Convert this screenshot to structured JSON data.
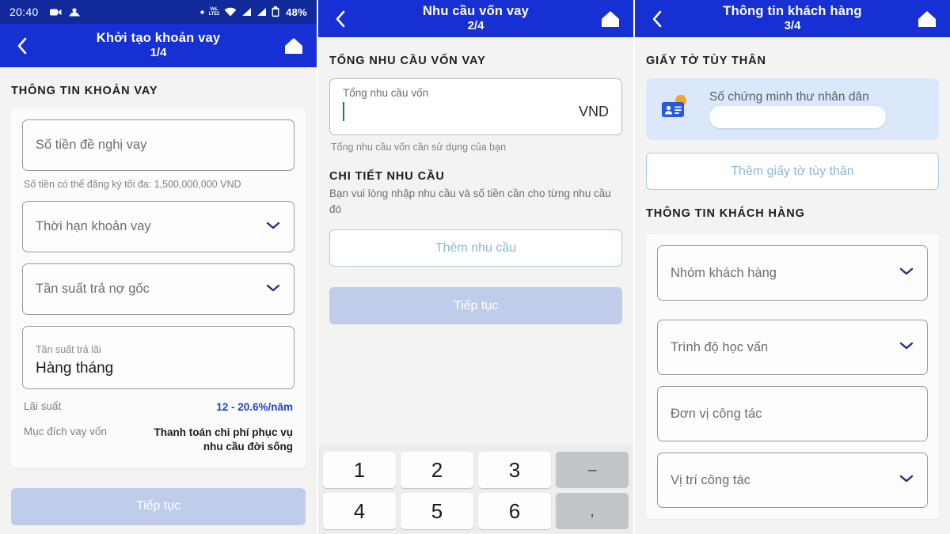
{
  "status_bar": {
    "time": "20:40",
    "battery": "48%",
    "network_label": "LTE2",
    "icons": [
      "camera-icon",
      "vpn-icon",
      "dot-icon",
      "volte-icon",
      "wifi-icon",
      "signal-icon",
      "signal-2-icon",
      "battery-icon"
    ]
  },
  "panel1": {
    "header": {
      "title": "Khởi tạo khoản vay",
      "step": "1/4",
      "back": "‹",
      "home": "home-icon"
    },
    "section_title": "THÔNG TIN KHOẢN VAY",
    "amount_placeholder": "Số tiền đề nghị vay",
    "amount_helper": "Số tiền có thể đăng ký tối đa: 1,500,000,000 VND",
    "term_placeholder": "Thời hạn khoản vay",
    "principal_freq_placeholder": "Tần suất trả nợ gốc",
    "interest_freq_label": "Tần suất trả lãi",
    "interest_freq_value": "Hàng tháng",
    "rate_key": "Lãi suất",
    "rate_value": "12 - 20.6%/năm",
    "purpose_key": "Mục đích vay vốn",
    "purpose_value": "Thanh toán chi phí phục vụ nhu cầu đời sống",
    "continue_label": "Tiếp tục"
  },
  "panel2": {
    "header": {
      "title": "Nhu cầu vốn vay",
      "step": "2/4",
      "back": "‹",
      "home": "home-icon"
    },
    "section_title": "TỔNG NHU CẦU VỐN VAY",
    "total_label": "Tổng nhu cầu vốn",
    "total_value": "",
    "total_unit": "VND",
    "total_helper": "Tổng nhu cầu vốn cần sử dụng của bạn",
    "detail_title": "CHI TIẾT NHU CẦU",
    "detail_desc": "Bạn vui lòng nhập nhu cầu và số tiền cần cho từng nhu cầu đó",
    "add_need_label": "Thêm nhu cầu",
    "continue_label": "Tiếp tục",
    "keyboard": {
      "row1": [
        "1",
        "2",
        "3",
        "–"
      ],
      "row2": [
        "4",
        "5",
        "6",
        ","
      ]
    }
  },
  "panel3": {
    "header": {
      "title": "Thông tin khách hàng",
      "step": "3/4",
      "back": "‹",
      "home": "home-icon"
    },
    "section_title": "GIẤY TỜ TÙY THÂN",
    "id_card_label": "Số chứng minh thư nhân dân",
    "id_card_value": "",
    "add_id_label": "Thêm giấy tờ tùy thân",
    "customer_section_title": "THÔNG TIN KHÁCH HÀNG",
    "fields": [
      {
        "label": "Nhóm khách hàng",
        "chevron": true
      },
      {
        "label": "Trình độ học vấn",
        "chevron": true
      },
      {
        "label": "Đơn vị công tác",
        "chevron": false
      },
      {
        "label": "Vị trí công tác",
        "chevron": true
      }
    ]
  },
  "colors": {
    "header_blue": "#1630d4",
    "status_blue": "#102a9c",
    "accent_blue": "#2340d8",
    "primary_btn": "#bfcdea",
    "outline_border": "#a9cde2",
    "id_card_bg": "#dbe8fb",
    "page_bg": "#f3f3f1"
  }
}
